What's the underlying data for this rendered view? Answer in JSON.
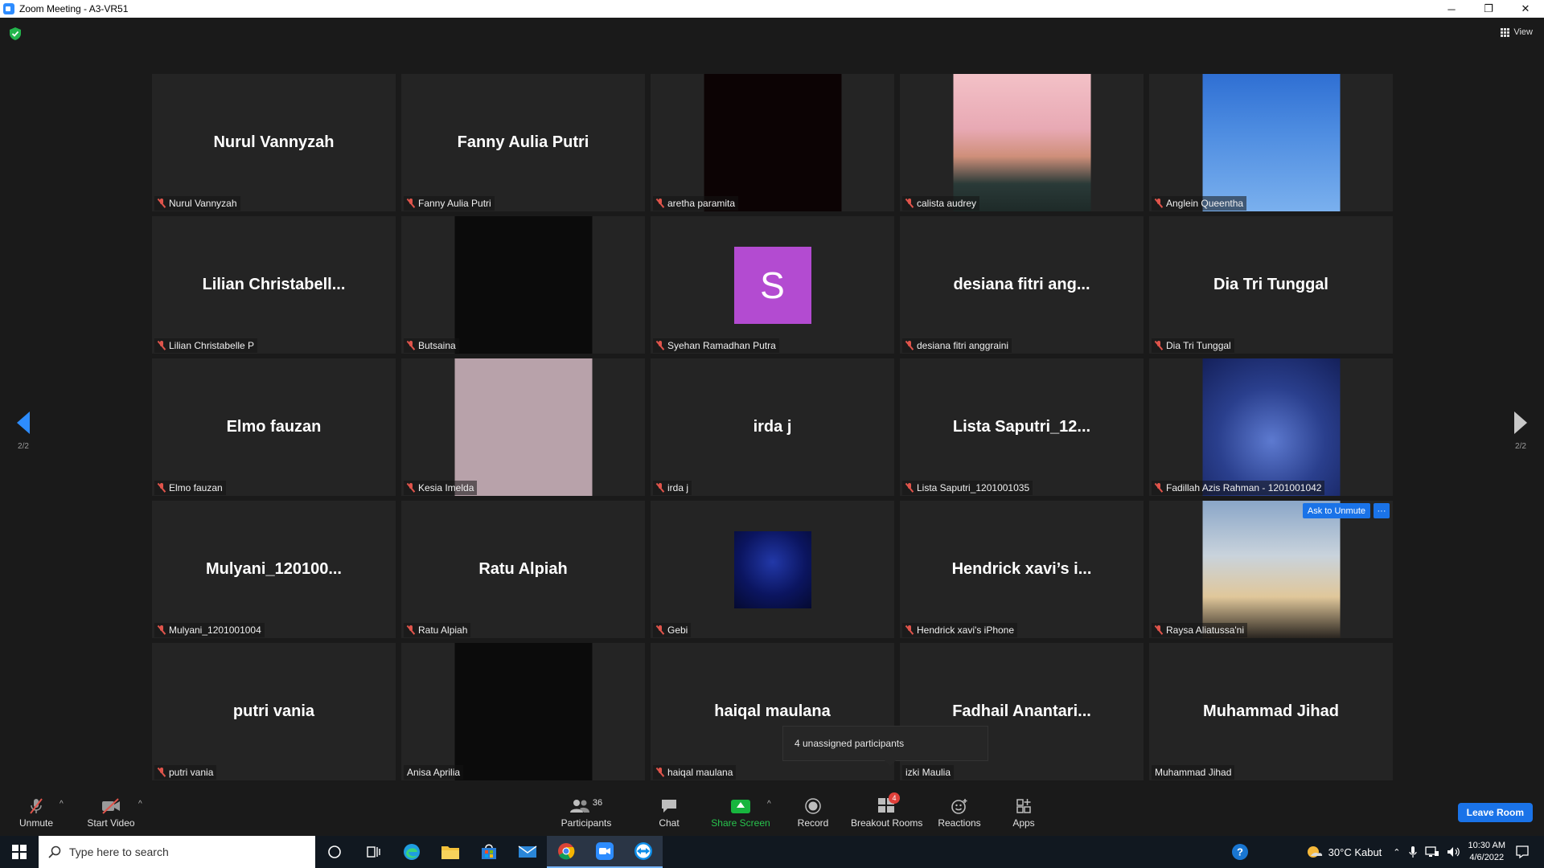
{
  "window": {
    "title": "Zoom Meeting - A3-VR51",
    "minimize": "─",
    "restore": "❐",
    "close": "✕"
  },
  "top": {
    "view_label": "View"
  },
  "pager": {
    "left": "2/2",
    "right": "2/2"
  },
  "tiles": [
    {
      "big": "Nurul Vannyzah",
      "label": "Nurul Vannyzah",
      "muted": true,
      "video": ""
    },
    {
      "big": "Fanny Aulia Putri",
      "label": "Fanny Aulia Putri",
      "muted": true,
      "video": ""
    },
    {
      "big": "",
      "label": "aretha paramita",
      "muted": true,
      "video": "dark"
    },
    {
      "big": "",
      "label": "calista audrey",
      "muted": true,
      "video": "girl"
    },
    {
      "big": "",
      "label": "Anglein Queentha",
      "muted": true,
      "video": "sky"
    },
    {
      "big": "Lilian  Christabell...",
      "label": "Lilian Christabelle P",
      "muted": true,
      "video": ""
    },
    {
      "big": "",
      "label": "Butsaina",
      "muted": true,
      "video": "black"
    },
    {
      "big": "",
      "label": "Syehan Ramadhan Putra",
      "muted": true,
      "video": "avatar-s",
      "avatar_letter": "S"
    },
    {
      "big": "desiana fitri ang...",
      "label": "desiana fitri anggraini",
      "muted": true,
      "video": ""
    },
    {
      "big": "Dia Tri Tunggal",
      "label": "Dia Tri Tunggal",
      "muted": true,
      "video": ""
    },
    {
      "big": "Elmo fauzan",
      "label": "Elmo fauzan",
      "muted": true,
      "video": ""
    },
    {
      "big": "",
      "label": "Kesia Imelda",
      "muted": true,
      "video": "pink"
    },
    {
      "big": "irda j",
      "label": "irda j",
      "muted": true,
      "video": ""
    },
    {
      "big": "Lista  Saputri_12...",
      "label": "Lista Saputri_1201001035",
      "muted": true,
      "video": ""
    },
    {
      "big": "",
      "label": "Fadillah Azis Rahman - 1201001042",
      "muted": true,
      "video": "night"
    },
    {
      "big": "Mulyani_120100...",
      "label": "Mulyani_1201001004",
      "muted": true,
      "video": ""
    },
    {
      "big": "Ratu Alpiah",
      "label": "Ratu Alpiah",
      "muted": true,
      "video": ""
    },
    {
      "big": "",
      "label": "Gebi",
      "muted": true,
      "video": "avatar-gebi"
    },
    {
      "big": "Hendrick xavi’s i...",
      "label": "Hendrick xavi's iPhone",
      "muted": true,
      "video": ""
    },
    {
      "big": "",
      "label": "Raysa Aliatussa'ni",
      "muted": true,
      "video": "sunset",
      "ask_unmute": "Ask to Unmute",
      "more": "···"
    },
    {
      "big": "putri vania",
      "label": "putri vania",
      "muted": true,
      "video": ""
    },
    {
      "big": "",
      "label": "Anisa Aprilia",
      "muted": false,
      "video": "black"
    },
    {
      "big": "haiqal maulana",
      "label": "haiqal maulana",
      "muted": true,
      "video": ""
    },
    {
      "big": "Fadhail  Anantari...",
      "label": "izki Maulia",
      "muted": false,
      "video": ""
    },
    {
      "big": "Muhammad Jihad",
      "label": "Muhammad Jihad",
      "muted": false,
      "video": ""
    }
  ],
  "tooltip": {
    "text": "4 unassigned participants"
  },
  "toolbar": {
    "unmute": "Unmute",
    "start_video": "Start Video",
    "participants": "Participants",
    "participants_count": "36",
    "chat": "Chat",
    "share_screen": "Share Screen",
    "record": "Record",
    "breakout_rooms": "Breakout Rooms",
    "breakout_badge": "4",
    "reactions": "Reactions",
    "apps": "Apps",
    "leave_room": "Leave Room",
    "caret": "^"
  },
  "taskbar": {
    "search_placeholder": "Type here to search",
    "weather": "30°C  Kabut",
    "time": "10:30 AM",
    "date": "4/6/2022"
  },
  "colors": {
    "accent": "#2d8cff",
    "muted_mic": "#e0544b",
    "share_green": "#17b53e",
    "leave_blue": "#1a73e8"
  }
}
